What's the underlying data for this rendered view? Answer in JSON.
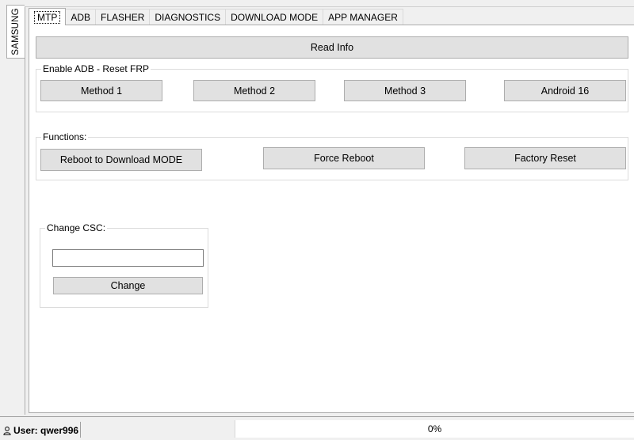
{
  "side_tab": {
    "label": "SAMSUNG"
  },
  "tabs": [
    {
      "label": "MTP",
      "active": true
    },
    {
      "label": "ADB"
    },
    {
      "label": "FLASHER"
    },
    {
      "label": "DIAGNOSTICS"
    },
    {
      "label": "DOWNLOAD MODE"
    },
    {
      "label": "APP MANAGER"
    }
  ],
  "mtp": {
    "read_info_label": "Read Info",
    "adb_group": {
      "title": "Enable ADB - Reset FRP",
      "buttons": [
        "Method 1",
        "Method 2",
        "Method 3",
        "Android 16"
      ]
    },
    "functions_group": {
      "title": "Functions:",
      "buttons": [
        "Reboot to Download MODE",
        "Force Reboot",
        "Factory Reset"
      ]
    },
    "csc_group": {
      "title": "Change CSC:",
      "input_value": "",
      "button_label": "Change"
    }
  },
  "status_bar": {
    "user_label": "User: qwer996",
    "progress_text": "0%",
    "progress_value": 0
  },
  "colors": {
    "progress_fill": "#06b025"
  }
}
